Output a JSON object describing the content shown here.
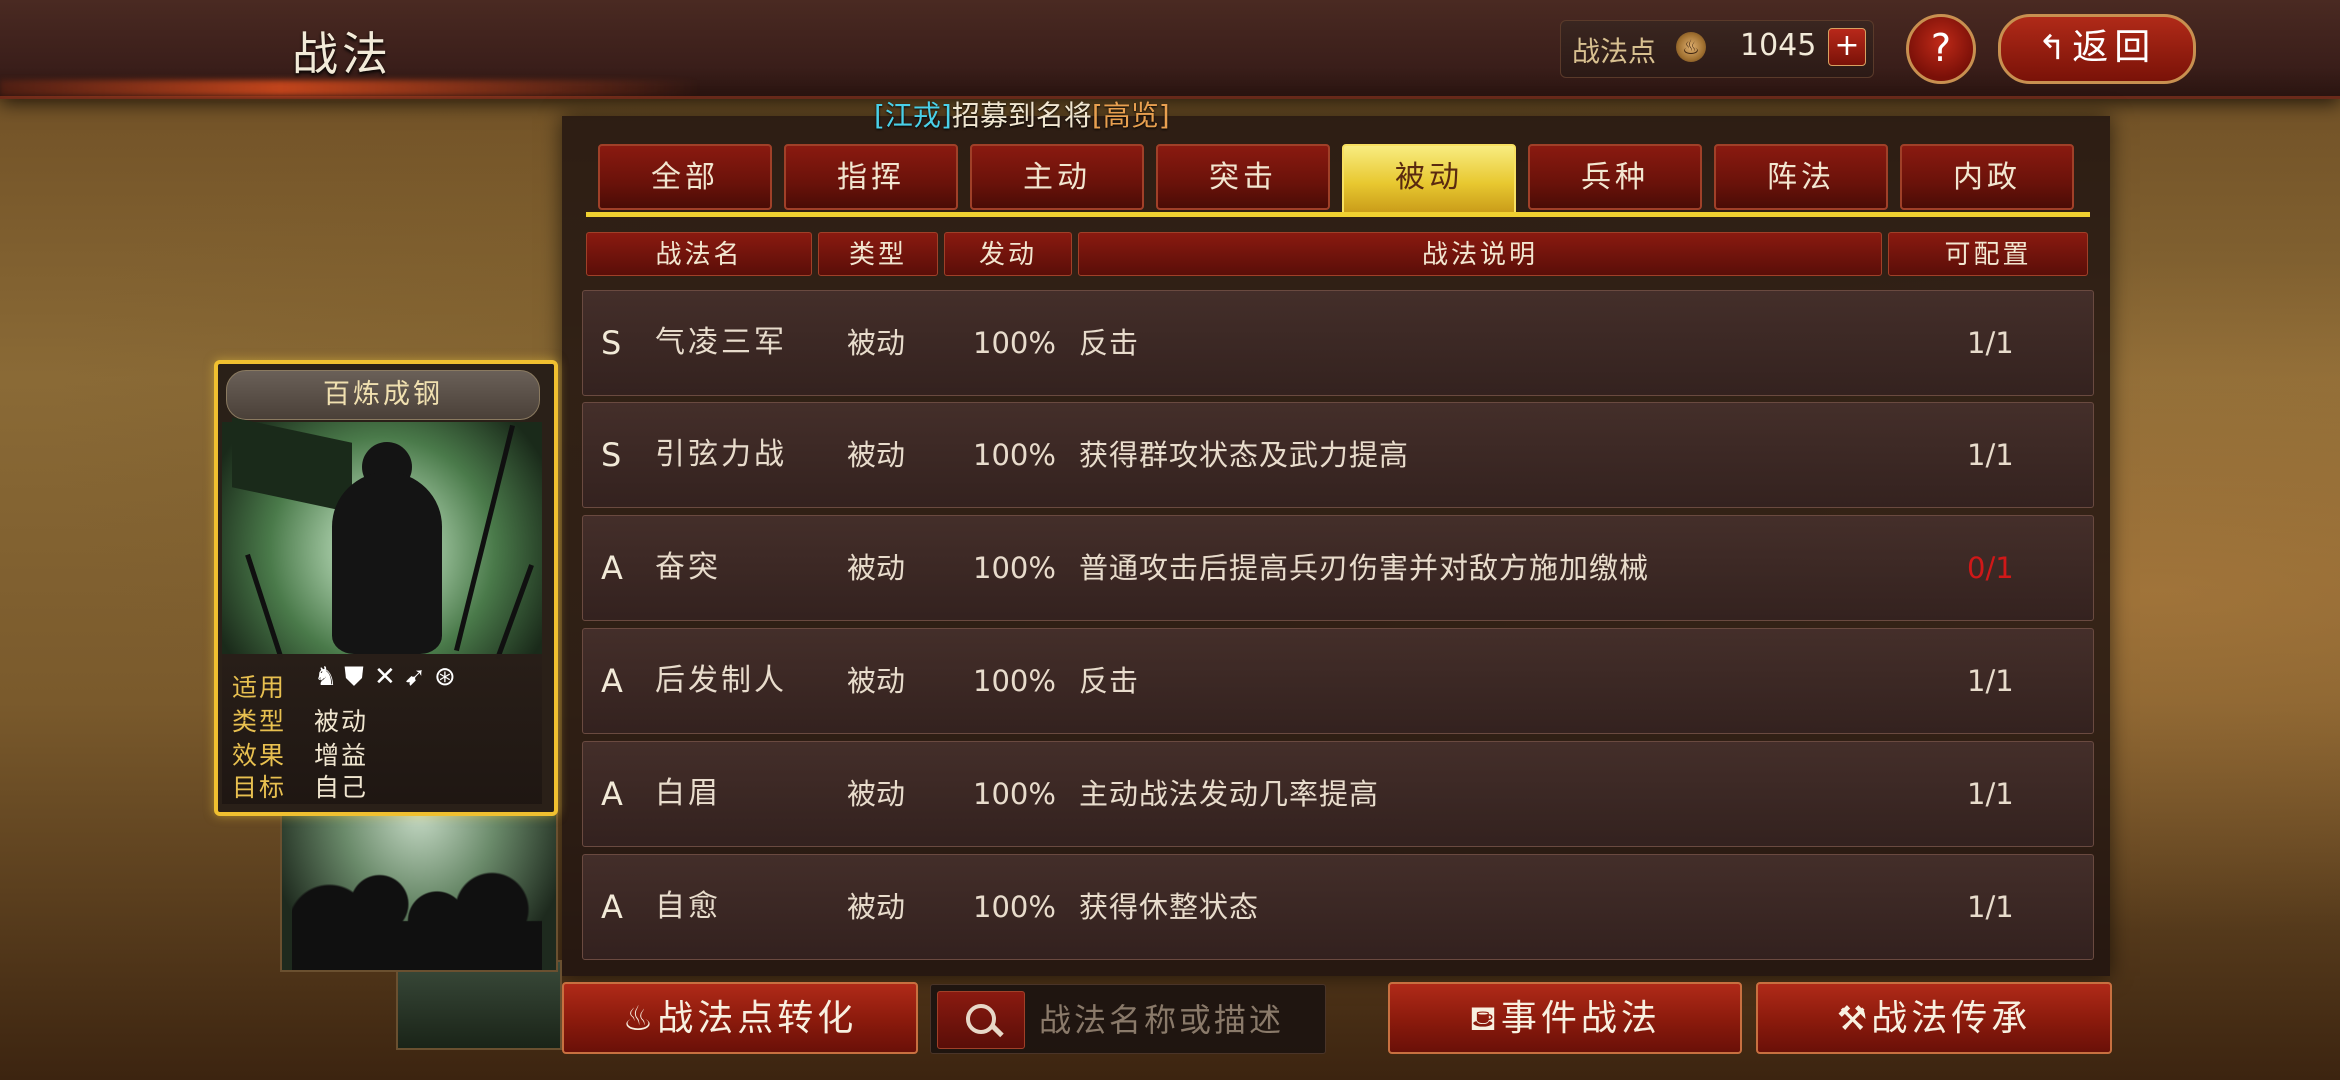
{
  "header": {
    "title": "战法",
    "points_label": "战法点",
    "points_value": "1045",
    "plus": "+",
    "help": "?",
    "back_label": "返回",
    "back_arrow": "↰"
  },
  "notice": {
    "name": "[江戎]",
    "text": "招募到名将",
    "hero": "[高览]"
  },
  "tabs": [
    {
      "label": "全部",
      "active": false
    },
    {
      "label": "指挥",
      "active": false
    },
    {
      "label": "主动",
      "active": false
    },
    {
      "label": "突击",
      "active": false
    },
    {
      "label": "被动",
      "active": true
    },
    {
      "label": "兵种",
      "active": false
    },
    {
      "label": "阵法",
      "active": false
    },
    {
      "label": "内政",
      "active": false
    }
  ],
  "columns": {
    "name": "战法名",
    "type": "类型",
    "rate": "发动",
    "desc": "战法说明",
    "count": "可配置"
  },
  "rows": [
    {
      "grade": "S",
      "name": "气凌三军",
      "type": "被动",
      "rate": "100%",
      "desc": "反击",
      "count": "1/1"
    },
    {
      "grade": "S",
      "name": "引弦力战",
      "type": "被动",
      "rate": "100%",
      "desc": "获得群攻状态及武力提高",
      "count": "1/1"
    },
    {
      "grade": "A",
      "name": "奋突",
      "type": "被动",
      "rate": "100%",
      "desc": "普通攻击后提高兵刃伤害并对敌方施加缴械",
      "count": "0/1"
    },
    {
      "grade": "A",
      "name": "后发制人",
      "type": "被动",
      "rate": "100%",
      "desc": "反击",
      "count": "1/1"
    },
    {
      "grade": "A",
      "name": "白眉",
      "type": "被动",
      "rate": "100%",
      "desc": "主动战法发动几率提高",
      "count": "1/1"
    },
    {
      "grade": "A",
      "name": "自愈",
      "type": "被动",
      "rate": "100%",
      "desc": "获得休整状态",
      "count": "1/1"
    }
  ],
  "card": {
    "title": "百炼成钢",
    "labels": {
      "apply": "适用",
      "type": "类型",
      "effect": "效果",
      "target": "目标"
    },
    "type": "被动",
    "effect": "增益",
    "target": "自己",
    "troop_icons": [
      "cavalry-icon",
      "shield-icon",
      "archer-icon",
      "spear-icon",
      "siege-icon"
    ]
  },
  "bottom": {
    "convert_label": "战法点转化",
    "search_placeholder": "战法名称或描述",
    "event_label": "事件战法",
    "inherit_label": "战法传承"
  },
  "colors": {
    "active_tab": "#e8c830",
    "zero_count": "#d01818",
    "button_red": "#8a1a0c"
  }
}
